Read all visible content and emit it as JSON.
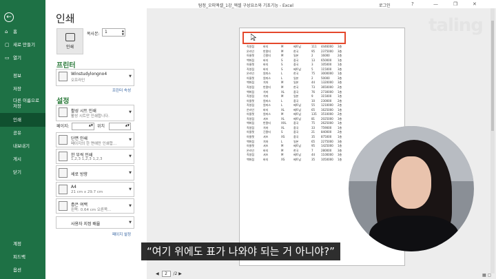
{
  "titlebar": {
    "title": "탐정_오피엑셀_1강_엑셀 구성요소와 기초기능 - Excel",
    "login": "로그인",
    "help": "?",
    "minimize": "—",
    "restore": "❐",
    "close": "✕"
  },
  "brand": "taling",
  "nav": {
    "back": "←",
    "items": [
      {
        "label": "홈",
        "icon": "⌂"
      },
      {
        "label": "새로 만들기",
        "icon": "▢"
      },
      {
        "label": "열기",
        "icon": "▭"
      },
      {
        "label": "정보",
        "icon": ""
      },
      {
        "label": "저장",
        "icon": ""
      },
      {
        "label": "다른 이름으로 저장",
        "icon": ""
      },
      {
        "label": "인쇄",
        "icon": ""
      },
      {
        "label": "공유",
        "icon": ""
      },
      {
        "label": "내보내기",
        "icon": ""
      },
      {
        "label": "게시",
        "icon": ""
      },
      {
        "label": "닫기",
        "icon": ""
      }
    ],
    "bottom": [
      "계정",
      "피드백",
      "옵션"
    ]
  },
  "print": {
    "heading": "인쇄",
    "print_button": "인쇄",
    "copies_label": "복사본:",
    "copies_value": "1",
    "printer_heading": "프린터",
    "printer_name": "Winstudylongno4",
    "printer_status": "오프라인",
    "printer_props": "프린터 속성",
    "settings_heading": "설정",
    "sheet_l1": "활성 시트 인쇄",
    "sheet_l2": "활성 시트만 인쇄합니다.",
    "pages_label": "페이지:",
    "to_label": "위치",
    "sides_l1": "단면 인쇄",
    "sides_l2": "페이지의 한 면에만 인쇄합...",
    "collate_l1": "한 부씩 인쇄",
    "collate_l2": "1,2,3    1,2,3    1,2,3",
    "orient_l1": "세로 방향",
    "paper_l1": "A4",
    "paper_l2": "21 cm x 29.7 cm",
    "margin_l1": "좁은 여백",
    "margin_l2": "왼쪽:  0.64 cm    오른쪽...",
    "scale_l1": "사용자 지정 배율",
    "page_setup": "페이지 설정"
  },
  "preview": {
    "rows": [
      [
        "직영점",
        "바지",
        "M",
        "베트남",
        "111",
        "4446000",
        "3층"
      ],
      [
        "온라인",
        "반팔티",
        "M",
        "한국",
        "95",
        "2375000",
        "3층"
      ],
      [
        "아울렛",
        "긴팔티",
        "M",
        "일본",
        "2",
        "16000",
        "2층"
      ],
      [
        "백화점",
        "바지",
        "S",
        "중국",
        "13",
        "650000",
        "1층"
      ],
      [
        "아울렛",
        "바지",
        "S",
        "중국",
        "3",
        "105000",
        "1층"
      ],
      [
        "직영점",
        "바지",
        "S",
        "베트남",
        "5",
        "115000",
        "3층"
      ],
      [
        "온라인",
        "원피스",
        "L",
        "한국",
        "75",
        "3000000",
        "1층"
      ],
      [
        "아울렛",
        "원피스",
        "L",
        "일본",
        "2",
        "50000",
        "3층"
      ],
      [
        "백화점",
        "치마",
        "M",
        "일본",
        "44",
        "1320000",
        "3층"
      ],
      [
        "직영점",
        "반팔티",
        "M",
        "한국",
        "73",
        "3650000",
        "2층"
      ],
      [
        "백화점",
        "치마",
        "XL",
        "중국",
        "76",
        "2730000",
        "1층"
      ],
      [
        "직영점",
        "치마",
        "M",
        "일본",
        "9",
        "315000",
        "1층"
      ],
      [
        "아울렛",
        "원피스",
        "L",
        "중국",
        "10",
        "230000",
        "2층"
      ],
      [
        "직영점",
        "원피스",
        "L",
        "베트남",
        "55",
        "1210000",
        "2층"
      ],
      [
        "온라인",
        "바지",
        "XL",
        "베트남",
        "65",
        "1625000",
        "1층"
      ],
      [
        "아울렛",
        "원피스",
        "M",
        "베트남",
        "135",
        "3510000",
        "2층"
      ],
      [
        "직영점",
        "셔츠",
        "XL",
        "베트남",
        "81",
        "2025000",
        "3층"
      ],
      [
        "백화점",
        "반팔티",
        "XXL",
        "중국",
        "75",
        "2625000",
        "1층"
      ],
      [
        "직영점",
        "치마",
        "XL",
        "중국",
        "33",
        "759000",
        "1층"
      ],
      [
        "아울렛",
        "긴팔티",
        "S",
        "중국",
        "21",
        "840000",
        "2층"
      ],
      [
        "아울렛",
        "셔츠",
        "XS",
        "중국",
        "35",
        "875000",
        "1층"
      ],
      [
        "백화점",
        "치마",
        "L",
        "일본",
        "65",
        "2275000",
        "3층"
      ],
      [
        "아울렛",
        "셔츠",
        "M",
        "베트남",
        "95",
        "1425000",
        "1층"
      ],
      [
        "온라인",
        "바지",
        "M",
        "한국",
        "7",
        "280000",
        "3층"
      ],
      [
        "직영점",
        "셔츠",
        "M",
        "베트남",
        "44",
        "1100000",
        "3층"
      ],
      [
        "백화점",
        "바지",
        "XS",
        "베트남",
        "35",
        "1050000",
        "1층"
      ]
    ],
    "current_page": "2",
    "total_pages": "/2",
    "prev_icon": "◀",
    "next_icon": "▶"
  },
  "caption": "“여기 위에도 표가 나와야 되는 거 아니야?”",
  "colors": {
    "nav_green": "#1e7145",
    "highlight_red": "#e4472b",
    "section_green": "#2b7a3a"
  }
}
